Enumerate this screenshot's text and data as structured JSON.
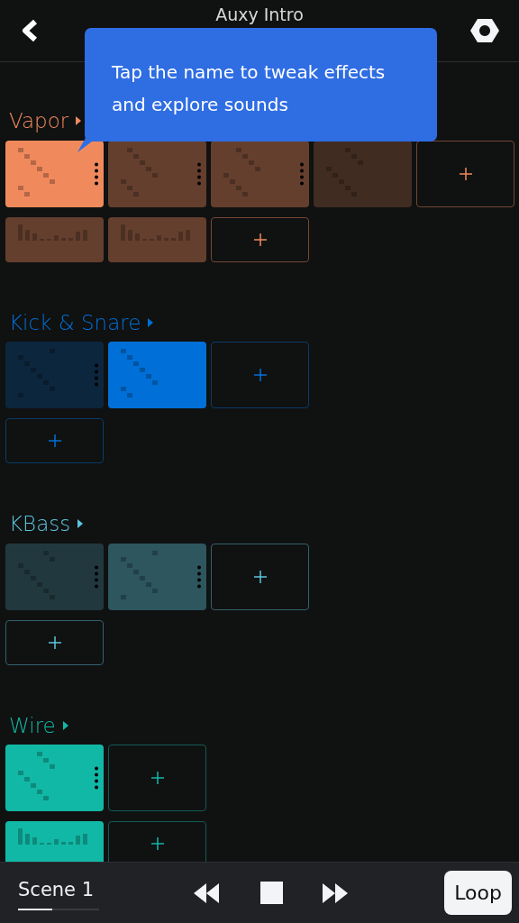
{
  "header": {
    "title": "Auxy Intro"
  },
  "tooltip": {
    "text": "Tap the name to tweak effects and explore sounds"
  },
  "tracks": [
    {
      "name": "Vapor",
      "color": "#f08a5d",
      "rows": [
        {
          "tiles": [
            {
              "kind": "notes",
              "selected": true,
              "muted": false,
              "menu": true
            },
            {
              "kind": "notes",
              "selected": false,
              "muted": false,
              "menu": true
            },
            {
              "kind": "notes",
              "selected": false,
              "muted": false,
              "menu": true
            },
            {
              "kind": "notes",
              "selected": false,
              "muted": true,
              "menu": false
            },
            {
              "kind": "add"
            }
          ]
        },
        {
          "tiles": [
            {
              "kind": "bars",
              "selected": false,
              "muted": false,
              "menu": false
            },
            {
              "kind": "bars",
              "selected": false,
              "muted": false,
              "menu": false
            },
            {
              "kind": "add"
            }
          ]
        }
      ]
    },
    {
      "name": "Kick & Snare",
      "color": "#0070d8",
      "rows": [
        {
          "tiles": [
            {
              "kind": "notes",
              "selected": false,
              "muted": true,
              "menu": true
            },
            {
              "kind": "notes",
              "selected": true,
              "muted": false,
              "menu": false
            },
            {
              "kind": "add"
            }
          ]
        },
        {
          "tiles": [
            {
              "kind": "add"
            }
          ]
        }
      ]
    },
    {
      "name": "KBass",
      "color": "#5cc6de",
      "rows": [
        {
          "tiles": [
            {
              "kind": "notes",
              "selected": false,
              "muted": true,
              "menu": true
            },
            {
              "kind": "notes",
              "selected": false,
              "muted": false,
              "menu": true
            },
            {
              "kind": "add"
            }
          ]
        },
        {
          "tiles": [
            {
              "kind": "add"
            }
          ]
        }
      ]
    },
    {
      "name": "Wire",
      "color": "#12b8a6",
      "rows": [
        {
          "tiles": [
            {
              "kind": "notes",
              "selected": true,
              "muted": false,
              "menu": true
            },
            {
              "kind": "add"
            }
          ]
        },
        {
          "tiles": [
            {
              "kind": "bars",
              "selected": true,
              "muted": false,
              "menu": false
            },
            {
              "kind": "add"
            }
          ]
        }
      ]
    }
  ],
  "transport": {
    "scene": "Scene 1",
    "level": 0.42,
    "loop": "Loop"
  }
}
